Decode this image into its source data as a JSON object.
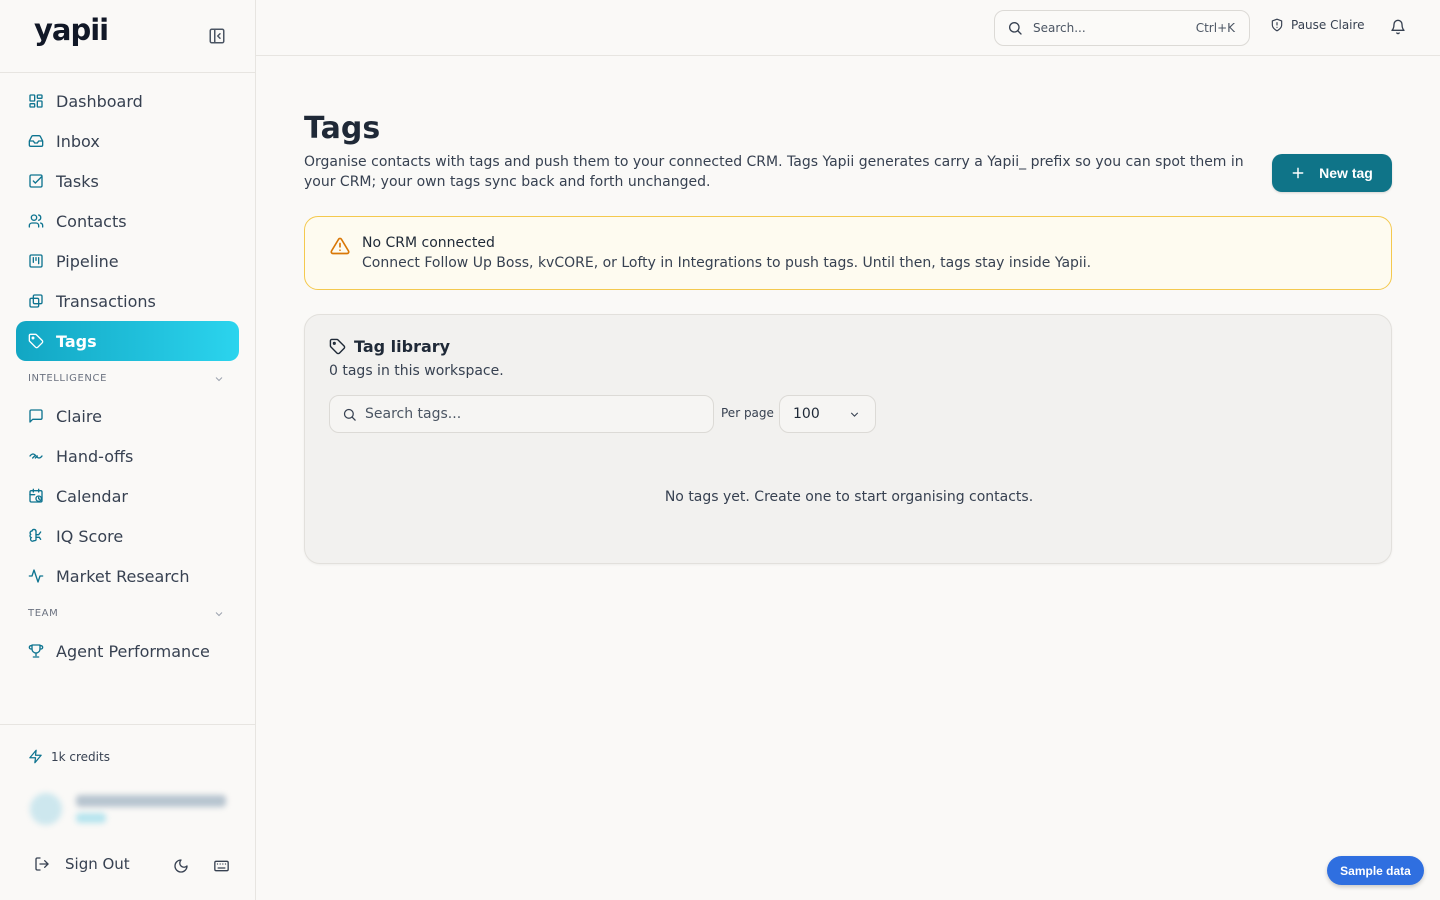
{
  "brand": {
    "logo": "yapii"
  },
  "sidebar": {
    "items": [
      {
        "label": "Dashboard",
        "icon": "dashboard-icon"
      },
      {
        "label": "Inbox",
        "icon": "inbox-icon"
      },
      {
        "label": "Tasks",
        "icon": "tasks-icon"
      },
      {
        "label": "Contacts",
        "icon": "contacts-icon"
      },
      {
        "label": "Pipeline",
        "icon": "pipeline-icon"
      },
      {
        "label": "Transactions",
        "icon": "transactions-icon"
      },
      {
        "label": "Tags",
        "icon": "tag-icon",
        "active": true
      }
    ],
    "intelligence": {
      "heading": "INTELLIGENCE",
      "items": [
        {
          "label": "Claire",
          "icon": "chat-icon"
        },
        {
          "label": "Hand-offs",
          "icon": "handshake-icon"
        },
        {
          "label": "Calendar",
          "icon": "calendar-icon"
        },
        {
          "label": "IQ Score",
          "icon": "brain-icon"
        },
        {
          "label": "Market Research",
          "icon": "activity-icon"
        }
      ]
    },
    "team": {
      "heading": "TEAM",
      "items": [
        {
          "label": "Agent Performance",
          "icon": "trophy-icon"
        }
      ]
    },
    "footer": {
      "credits": "1k credits",
      "sign_out": "Sign Out"
    }
  },
  "topbar": {
    "search_placeholder": "Search...",
    "search_shortcut": "Ctrl+K",
    "pause_label": "Pause Claire"
  },
  "page": {
    "title": "Tags",
    "description": "Organise contacts with tags and push them to your connected CRM. Tags Yapii generates carry a Yapii_ prefix so you can spot them in your CRM; your own tags sync back and forth unchanged.",
    "new_tag_label": "New tag"
  },
  "alert": {
    "title": "No CRM connected",
    "text": "Connect Follow Up Boss, kvCORE, or Lofty in Integrations to push tags. Until then, tags stay inside Yapii."
  },
  "library": {
    "title": "Tag library",
    "subtitle": "0 tags in this workspace.",
    "search_placeholder": "Search tags...",
    "per_page_label": "Per page",
    "per_page_value": "100",
    "empty_message": "No tags yet. Create one to start organising contacts."
  },
  "sample_button": "Sample data",
  "colors": {
    "accent": "#0f7488",
    "active_nav": "#1fbcd9",
    "warning": "#d97706",
    "sample": "#2f6fe0"
  }
}
